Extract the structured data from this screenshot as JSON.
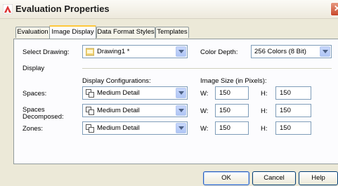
{
  "window": {
    "title": "Evaluation Properties",
    "close_glyph": "✕"
  },
  "tabs": [
    {
      "label": "Evaluation"
    },
    {
      "label": "Image Display",
      "active": true
    },
    {
      "label": "Data Format Styles"
    },
    {
      "label": "Templates"
    }
  ],
  "select_drawing": {
    "label": "Select Drawing:",
    "value": "Drawing1 *",
    "icon": "drawing-icon"
  },
  "color_depth": {
    "label": "Color Depth:",
    "value": "256 Colors (8 Bit)"
  },
  "display_section": {
    "label": "Display"
  },
  "headers": {
    "display_configurations": "Display Configurations:",
    "image_size": "Image Size (in Pixels):"
  },
  "rows": [
    {
      "label": "Spaces:",
      "config": "Medium Detail",
      "w_label": "W:",
      "w": "150",
      "h_label": "H:",
      "h": "150"
    },
    {
      "label": "Spaces Decomposed:",
      "config": "Medium Detail",
      "w_label": "W:",
      "w": "150",
      "h_label": "H:",
      "h": "150"
    },
    {
      "label": "Zones:",
      "config": "Medium Detail",
      "w_label": "W:",
      "w": "150",
      "h_label": "H:",
      "h": "150"
    }
  ],
  "buttons": {
    "ok": "OK",
    "cancel": "Cancel",
    "help": "Help"
  },
  "colors": {
    "accent_tab": "#ffc83c",
    "close_red": "#c8482b",
    "border_blue": "#7f9db9"
  }
}
